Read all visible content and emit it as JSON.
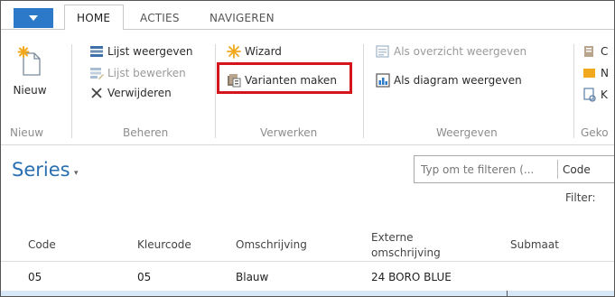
{
  "ribbon": {
    "tabs": [
      {
        "label": "HOME"
      },
      {
        "label": "ACTIES"
      },
      {
        "label": "NAVIGEREN"
      }
    ],
    "groups": {
      "nieuw": {
        "label": "Nieuw",
        "buttons": [
          {
            "label": "Nieuw",
            "icon": "new-document-icon"
          }
        ]
      },
      "beheren": {
        "label": "Beheren",
        "buttons": [
          {
            "label": "Lijst weergeven",
            "icon": "list-view-icon",
            "enabled": true
          },
          {
            "label": "Lijst bewerken",
            "icon": "list-edit-icon",
            "enabled": false
          },
          {
            "label": "Verwijderen",
            "icon": "delete-x-icon",
            "enabled": true
          }
        ]
      },
      "verwerken": {
        "label": "Verwerken",
        "buttons": [
          {
            "label": "Wizard",
            "icon": "wizard-star-icon",
            "enabled": true
          },
          {
            "label": "Varianten maken",
            "icon": "create-variants-icon",
            "enabled": true,
            "highlighted": true
          }
        ]
      },
      "weergeven": {
        "label": "Weergeven",
        "buttons": [
          {
            "label": "Als overzicht weergeven",
            "icon": "overview-icon",
            "enabled": false
          },
          {
            "label": "Als diagram weergeven",
            "icon": "chart-icon",
            "enabled": true
          }
        ]
      },
      "gekoppeld": {
        "label": "Geko",
        "buttons": [
          {
            "label": "C",
            "icon": "linked-icon"
          },
          {
            "label": "N",
            "icon": "note-icon"
          },
          {
            "label": "K",
            "icon": "link-icon"
          }
        ]
      }
    },
    "highlight_color": "#d4161c",
    "accent_color": "#2b79c8"
  },
  "page": {
    "title": "Series",
    "title_caret": "▾",
    "filter": {
      "placeholder": "Typ om te filteren (...",
      "field": "Code",
      "filter_label": "Filter:"
    }
  },
  "grid": {
    "columns": [
      "Code",
      "Kleurcode",
      "Omschrijving",
      "Externe omschrijving",
      "Submaat"
    ],
    "rows": [
      [
        "05",
        "05",
        "Blauw",
        "24 BORO BLUE",
        ""
      ]
    ]
  }
}
